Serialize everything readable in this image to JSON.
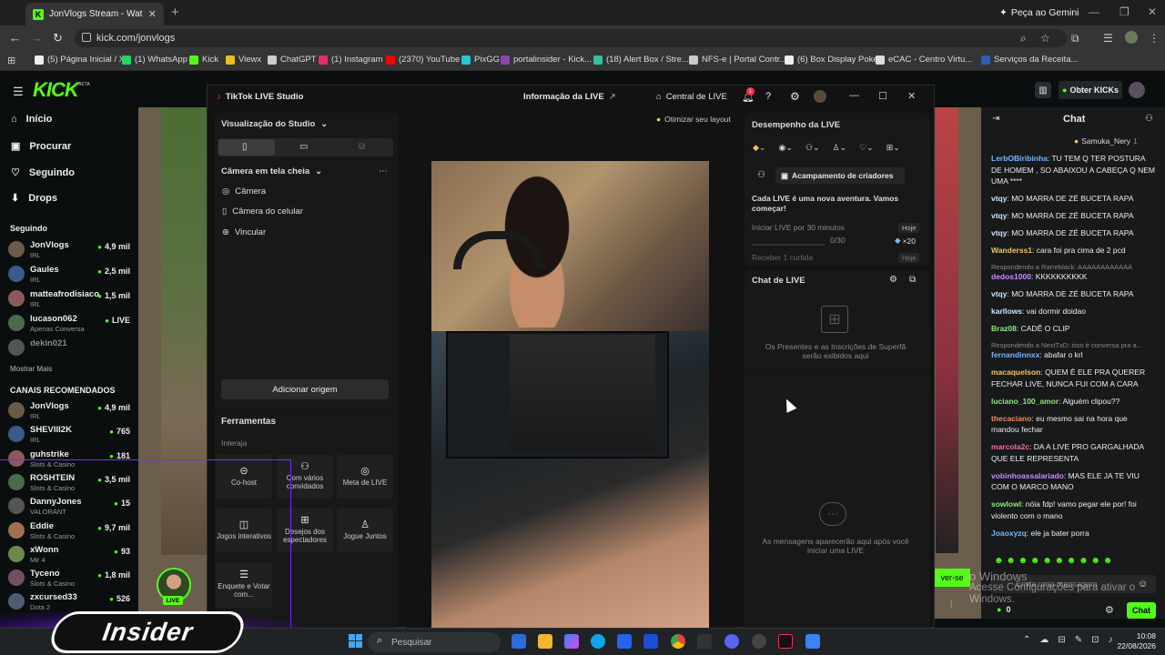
{
  "browser": {
    "tab_title": "JonVlogs Stream - Watch Live o",
    "tab_favicon": "K",
    "gemini": "Peça ao Gemini",
    "url": "kick.com/jonvlogs",
    "bookmarks": [
      {
        "label": "(5) Página Inicial / X",
        "color": "#eeeeee"
      },
      {
        "label": "(1) WhatsApp",
        "color": "#25d366"
      },
      {
        "label": "Kick",
        "color": "#53fc18"
      },
      {
        "label": "Viewx",
        "color": "#e6c020"
      },
      {
        "label": "ChatGPT",
        "color": "#cccccc"
      },
      {
        "label": "(1) Instagram",
        "color": "#e1306c"
      },
      {
        "label": "(2370) YouTube",
        "color": "#ff0000"
      },
      {
        "label": "PixGG",
        "color": "#26c6da"
      },
      {
        "label": "portalinsider - Kick...",
        "color": "#8e44ad"
      },
      {
        "label": "(18) Alert Box / Stre...",
        "color": "#31c3a2"
      },
      {
        "label": "NFS-e | Portal Contr...",
        "color": "#cccccc"
      },
      {
        "label": "(6) Box Display Poké...",
        "color": "#eeeeee"
      },
      {
        "label": "eCAC - Centro Virtu...",
        "color": "#dddddd"
      },
      {
        "label": "Serviços da Receita...",
        "color": "#2b5fb3"
      }
    ]
  },
  "kick": {
    "logo": "KICK",
    "beta": "BETA",
    "nav": [
      "Início",
      "Procurar",
      "Seguindo",
      "Drops"
    ],
    "following_title": "Seguindo",
    "following": [
      {
        "name": "JonVlogs",
        "cat": "IRL",
        "viewers": "4,9 mil"
      },
      {
        "name": "Gaules",
        "cat": "IRL",
        "viewers": "2,5 mil"
      },
      {
        "name": "matteafrodisiaco",
        "cat": "IRL",
        "viewers": "1,5 mil"
      },
      {
        "name": "lucason062",
        "cat": "Apenas Conversa",
        "viewers": "LIVE"
      },
      {
        "name": "dekin021",
        "cat": "",
        "viewers": ""
      }
    ],
    "show_more": "Mostrar Mais",
    "recommended_title": "CANAIS RECOMENDADOS",
    "recommended": [
      {
        "name": "JonVlogs",
        "cat": "IRL",
        "viewers": "4,9 mil"
      },
      {
        "name": "SHEVIII2K",
        "cat": "IRL",
        "viewers": "765"
      },
      {
        "name": "guhstrike",
        "cat": "Slots & Casino",
        "viewers": "181"
      },
      {
        "name": "ROSHTEIN",
        "cat": "Slots & Casino",
        "viewers": "3,5 mil"
      },
      {
        "name": "DannyJones",
        "cat": "VALORANT",
        "viewers": "15"
      },
      {
        "name": "Eddie",
        "cat": "Slots & Casino",
        "viewers": "9,7 mil"
      },
      {
        "name": "xWonn",
        "cat": "Mir 4",
        "viewers": "93"
      },
      {
        "name": "Tyceno",
        "cat": "Slots & Casino",
        "viewers": "1,8 mil"
      },
      {
        "name": "zxcursed33",
        "cat": "Dota 2",
        "viewers": "526"
      }
    ],
    "obter": "Obter KICKs",
    "chat_title": "Chat",
    "top_gifter": "Samuka_Nery",
    "top_gifter_count": "1",
    "live_badge": "LIVE",
    "chat_placeholder": "Envie uma mensagem",
    "chat_button": "Chat",
    "kicks_count": "0"
  },
  "chat": [
    {
      "user": "LerbOBiribinha",
      "color": "#7ab6ff",
      "text": "TU TEM Q TER POSTURA DE HOMEM , SO ABAIXOU A CABEÇA Q NEM UMA ****"
    },
    {
      "user": "vtqy",
      "color": "#cfe3ff",
      "text": "MO MARRA DE ZÉ BUCETA RAPA"
    },
    {
      "user": "vtqy",
      "color": "#cfe3ff",
      "text": "MO MARRA DE ZÉ BUCETA RAPA"
    },
    {
      "user": "vtqy",
      "color": "#cfe3ff",
      "text": "MO MARRA DE ZÉ BUCETA RAPA"
    },
    {
      "user": "Wanderss1",
      "color": "#f0c75e",
      "text": "cara foi pra cima de 2 pcd"
    },
    {
      "reply": "Respondendo a Rarreblack: AAAAAAAAAAAA"
    },
    {
      "user": "dedos1000",
      "color": "#c88bff",
      "text": "KKKKKKKKKK"
    },
    {
      "user": "vtqy",
      "color": "#cfe3ff",
      "text": "MO MARRA DE ZÉ BUCETA RAPA"
    },
    {
      "user": "karllows",
      "color": "#cfe3ff",
      "text": "vai dormir doidao"
    },
    {
      "user": "Braz08",
      "color": "#8ee87a",
      "text": "CADÊ O CLIP"
    },
    {
      "reply": "Respondendo a NextTxD: isso é conversa pra a..."
    },
    {
      "user": "fernandinnxx",
      "color": "#7ab6ff",
      "text": "abafar o krl"
    },
    {
      "user": "macaquelson",
      "color": "#f0c75e",
      "text": "QUEM É ELE PRA QUERER FECHAR LIVE, NUNCA FUI COM A CARA"
    },
    {
      "user": "luciano_100_amor",
      "color": "#8ee87a",
      "text": "Alguém clipou??"
    },
    {
      "user": "thecaciano",
      "color": "#f08a5e",
      "text": "eu mesmo sai na hora que mandou fechar"
    },
    {
      "user": "marcola2c",
      "color": "#f06ea0",
      "text": "DA A LIVE PRO GARGALHADA QUE ELE REPRESENTA"
    },
    {
      "user": "vobinhoassalariado",
      "color": "#c88bff",
      "text": "MAS ELE JA TE VIU COM O MARCO MANO"
    },
    {
      "user": "sowlowl",
      "color": "#8ee87a",
      "text": "nóia fdp! vamo pegar ele por! foi violento com o mano"
    },
    {
      "user": "Joaoxyzq",
      "color": "#7ab6ff",
      "text": "ele ja bater porra"
    }
  ],
  "tiktok": {
    "title": "TikTok LIVE Studio",
    "info": "Informação da LIVE",
    "central": "Central de LIVE",
    "notif_count": "1",
    "studio_view": "Visualização do Studio",
    "optimize": "Otimizar seu layout",
    "camera_full": "Câmera em tela cheia",
    "sources": [
      "Câmera",
      "Câmera do celular",
      "Vincular"
    ],
    "add_source": "Adicionar origem",
    "tools_title": "Ferramentas",
    "interact": "Interaja",
    "tools": [
      "Co-host",
      "Com vários convidados",
      "Meta de LIVE",
      "Jogos interativos",
      "Desejos dos espectadores",
      "Jogue Juntos",
      "Enquete e Votar com..."
    ],
    "perf_title": "Desempenho da LIVE",
    "camp": "Acampamento de criadores",
    "adventure": "Cada LIVE é uma nova aventura. Vamos começar!",
    "task1": "Iniciar LIVE por 30 minutos",
    "task1_tag": "Hoje",
    "task1_progress": "0/30",
    "task1_reward": "×20",
    "task2": "Receber 1 curtida",
    "task2_tag": "Hoje",
    "chat_live": "Chat de LIVE",
    "gifts_note": "Os Presentes e as Inscrições de Superfã serão exibidos aqui",
    "messages_note": "As mensagens aparecerão aqui após você iniciar uma LIVE"
  },
  "overlay": {
    "insider": "Insider",
    "win_line1": "o Windows",
    "win_line2": "Acesse Configurações para ativar o Windows.",
    "follow_partial": "ver-se"
  },
  "taskbar": {
    "search": "Pesquisar",
    "time": "10:08",
    "date": "22/08/2026"
  }
}
